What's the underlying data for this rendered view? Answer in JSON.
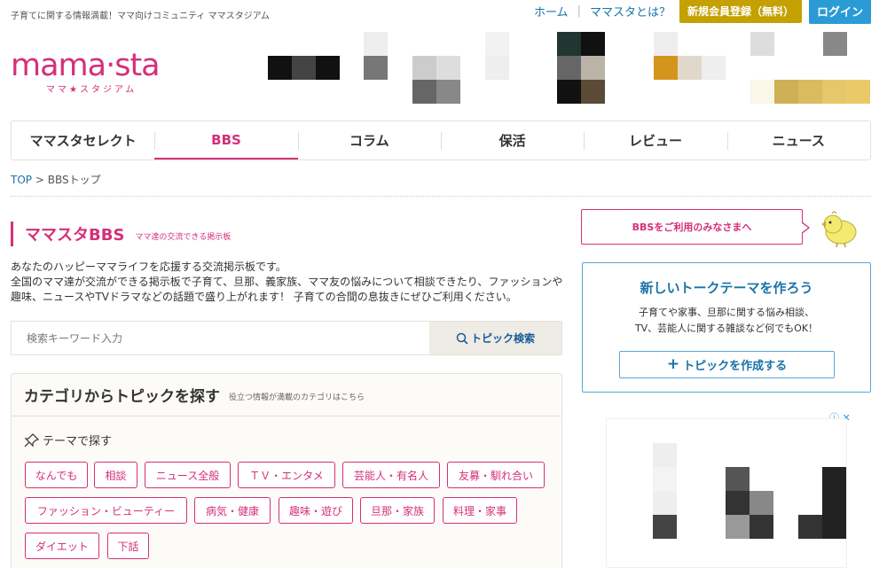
{
  "header": {
    "tagline": "子育てに関する情報満載！ママ向けコミュニティ ママスタジアム",
    "nav": {
      "home": "ホーム",
      "about": "ママスタとは？",
      "register": "新規会員登録（無料）",
      "login": "ログイン"
    },
    "logo": {
      "main": "mama·sta",
      "sub": "ママ★スタジアム"
    }
  },
  "main_nav": [
    "ママスタセレクト",
    "BBS",
    "コラム",
    "保活",
    "レビュー",
    "ニュース"
  ],
  "main_nav_active": "BBS",
  "breadcrumb": {
    "top": "TOP",
    "sep": ">",
    "current": "BBSトップ"
  },
  "bbs": {
    "title": "ママスタBBS",
    "subtitle": "ママ達の交流できる掲示板",
    "intro_line1": "あなたのハッピーママライフを応援する交流掲示板です。",
    "intro_line2": "全国のママ達が交流ができる掲示板で子育て、旦那、義家族、ママ友の悩みについて相談できたり、ファッションや趣味、ニュースやTVドラマなどの話題で盛り上がれます！ 子育ての合間の息抜きにぜひご利用ください。"
  },
  "search": {
    "placeholder": "検索キーワード入力",
    "button": "トピック検索"
  },
  "category": {
    "title": "カテゴリからトピックを探す",
    "subtitle": "役立つ情報が満載のカテゴリはこちら",
    "theme_label": "テーマで探す",
    "tags": [
      "なんでも",
      "相談",
      "ニュース全般",
      "ＴＶ・エンタメ",
      "芸能人・有名人",
      "友募・馴れ合い",
      "ファッション・ビューティー",
      "病気・健康",
      "趣味・遊び",
      "旦那・家族",
      "料理・家事",
      "ダイエット",
      "下話"
    ]
  },
  "sidebar": {
    "welcome": "BBSをご利用のみなさまへ",
    "new_topic": {
      "title": "新しいトークテーマを作ろう",
      "desc_line1": "子育てや家事、旦那に関する悩み相談、",
      "desc_line2": "TV、芸能人に関する雑談など何でもOK！",
      "button": "トピックを作成する"
    }
  },
  "colors": {
    "brand_pink": "#d4307a",
    "link_blue": "#1a73a8",
    "register_gold": "#c4a000",
    "login_blue": "#2b9bd6"
  }
}
